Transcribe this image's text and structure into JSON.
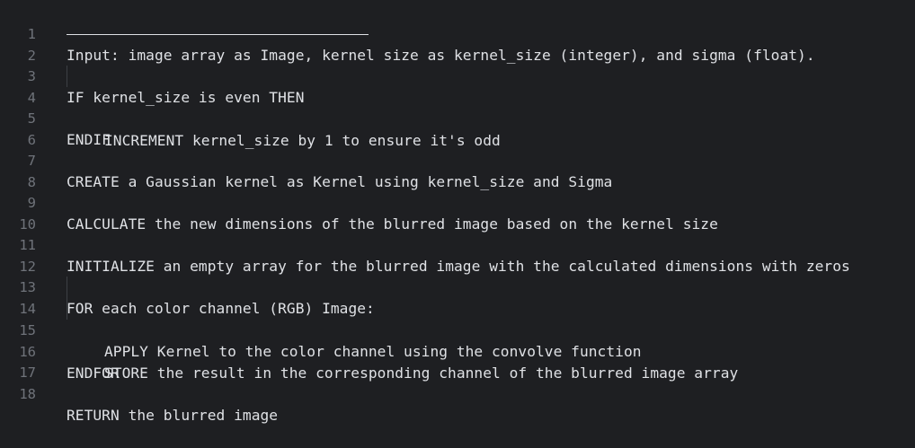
{
  "editor": {
    "lines": [
      {
        "number": "1",
        "text": "Input: image array as Image, kernel size as kernel_size (integer), and sigma (float)."
      },
      {
        "number": "2",
        "text": ""
      },
      {
        "number": "3",
        "text": "IF kernel_size is even THEN"
      },
      {
        "number": "4",
        "text": "INCREMENT kernel_size by 1 to ensure it's odd"
      },
      {
        "number": "5",
        "text": "ENDIF"
      },
      {
        "number": "6",
        "text": ""
      },
      {
        "number": "7",
        "text": "CREATE a Gaussian kernel as Kernel using kernel_size and Sigma"
      },
      {
        "number": "8",
        "text": ""
      },
      {
        "number": "9",
        "text": "CALCULATE the new dimensions of the blurred image based on the kernel size"
      },
      {
        "number": "10",
        "text": ""
      },
      {
        "number": "11",
        "text": "INITIALIZE an empty array for the blurred image with the calculated dimensions with zeros"
      },
      {
        "number": "12",
        "text": ""
      },
      {
        "number": "13",
        "text": "FOR each color channel (RGB) Image:"
      },
      {
        "number": "14",
        "text": "APPLY Kernel to the color channel using the convolve function"
      },
      {
        "number": "15",
        "text": "STORE the result in the corresponding channel of the blurred image array"
      },
      {
        "number": "16",
        "text": "ENDFOR"
      },
      {
        "number": "17",
        "text": ""
      },
      {
        "number": "18",
        "text": "RETURN the blurred image"
      }
    ]
  }
}
